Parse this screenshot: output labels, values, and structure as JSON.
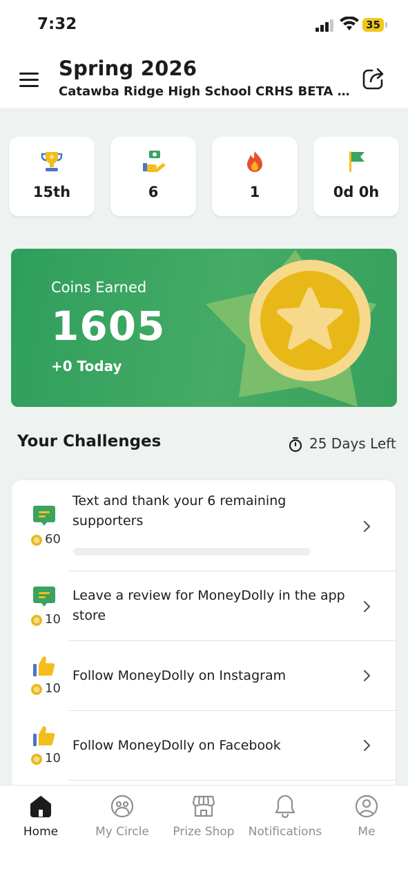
{
  "status_bar": {
    "time": "7:32",
    "battery": "35"
  },
  "header": {
    "title": "Spring 2026",
    "subtitle": "Catawba Ridge High School CRHS BETA C…"
  },
  "stats": [
    {
      "icon": "trophy-icon",
      "value": "15th"
    },
    {
      "icon": "hand-money-icon",
      "value": "6"
    },
    {
      "icon": "flame-icon",
      "value": "1"
    },
    {
      "icon": "flag-icon",
      "value": "0d 0h"
    }
  ],
  "coins": {
    "label": "Coins Earned",
    "value": "1605",
    "today": "+0 Today"
  },
  "challenges": {
    "title": "Your Challenges",
    "days_left": "25 Days Left",
    "items": [
      {
        "icon": "chat-icon",
        "points": "60",
        "text": "Text and thank your 6 remaining supporters",
        "progress": 0
      },
      {
        "icon": "chat-icon",
        "points": "10",
        "text": "Leave a review for MoneyDolly in the app store"
      },
      {
        "icon": "thumbs-up-icon",
        "points": "10",
        "text": "Follow MoneyDolly on Instagram"
      },
      {
        "icon": "thumbs-up-icon",
        "points": "10",
        "text": "Follow MoneyDolly on Facebook"
      }
    ]
  },
  "tabs": [
    {
      "label": "Home",
      "icon": "home-icon",
      "active": true
    },
    {
      "label": "My Circle",
      "icon": "circle-face-icon",
      "active": false
    },
    {
      "label": "Prize Shop",
      "icon": "shop-icon",
      "active": false
    },
    {
      "label": "Notifications",
      "icon": "bell-icon",
      "active": false
    },
    {
      "label": "Me",
      "icon": "profile-icon",
      "active": false
    }
  ],
  "colors": {
    "accent_green": "#3aa35f",
    "coin_gold": "#e8b818"
  }
}
